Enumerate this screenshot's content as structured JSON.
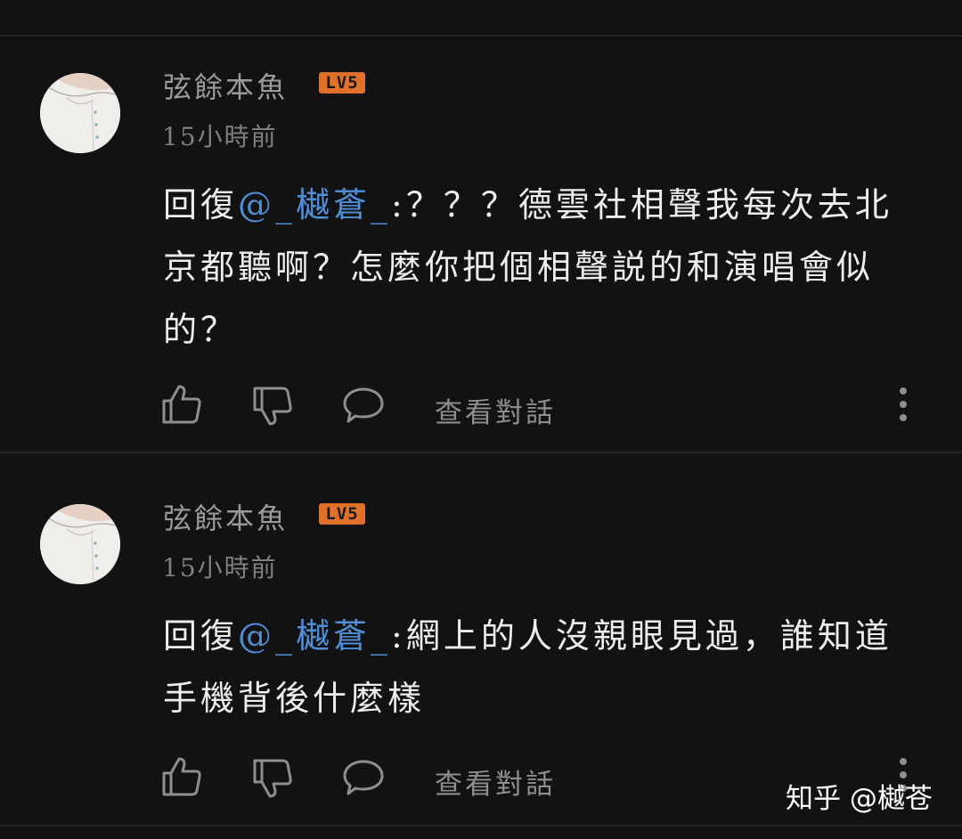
{
  "colors": {
    "background": "#121212",
    "divider": "#262626",
    "mention": "#4f8dd6",
    "badge": "#e1702a",
    "icon": "#8e8e8e"
  },
  "comments": [
    {
      "username": "弦餘本魚",
      "level_badge": "LV5",
      "timestamp": "15小時前",
      "reply_prefix": "回復",
      "mention": "@_樾蒼_",
      "text": ":？？？德雲社相聲我每次去北京都聽啊？怎麼你把個相聲説的和演唱會似的？",
      "actions": {
        "like_icon": "thumbs-up-icon",
        "dislike_icon": "thumbs-down-icon",
        "comment_icon": "speech-bubble-icon",
        "view_conversation_label": "查看對話",
        "more_icon": "vertical-dots-icon"
      }
    },
    {
      "username": "弦餘本魚",
      "level_badge": "LV5",
      "timestamp": "15小時前",
      "reply_prefix": "回復",
      "mention": "@_樾蒼_",
      "text": ":網上的人沒親眼見過，誰知道手機背後什麼樣",
      "actions": {
        "like_icon": "thumbs-up-icon",
        "dislike_icon": "thumbs-down-icon",
        "comment_icon": "speech-bubble-icon",
        "view_conversation_label": "查看對話",
        "more_icon": "vertical-dots-icon"
      }
    }
  ],
  "watermark": "知乎 @樾苍"
}
